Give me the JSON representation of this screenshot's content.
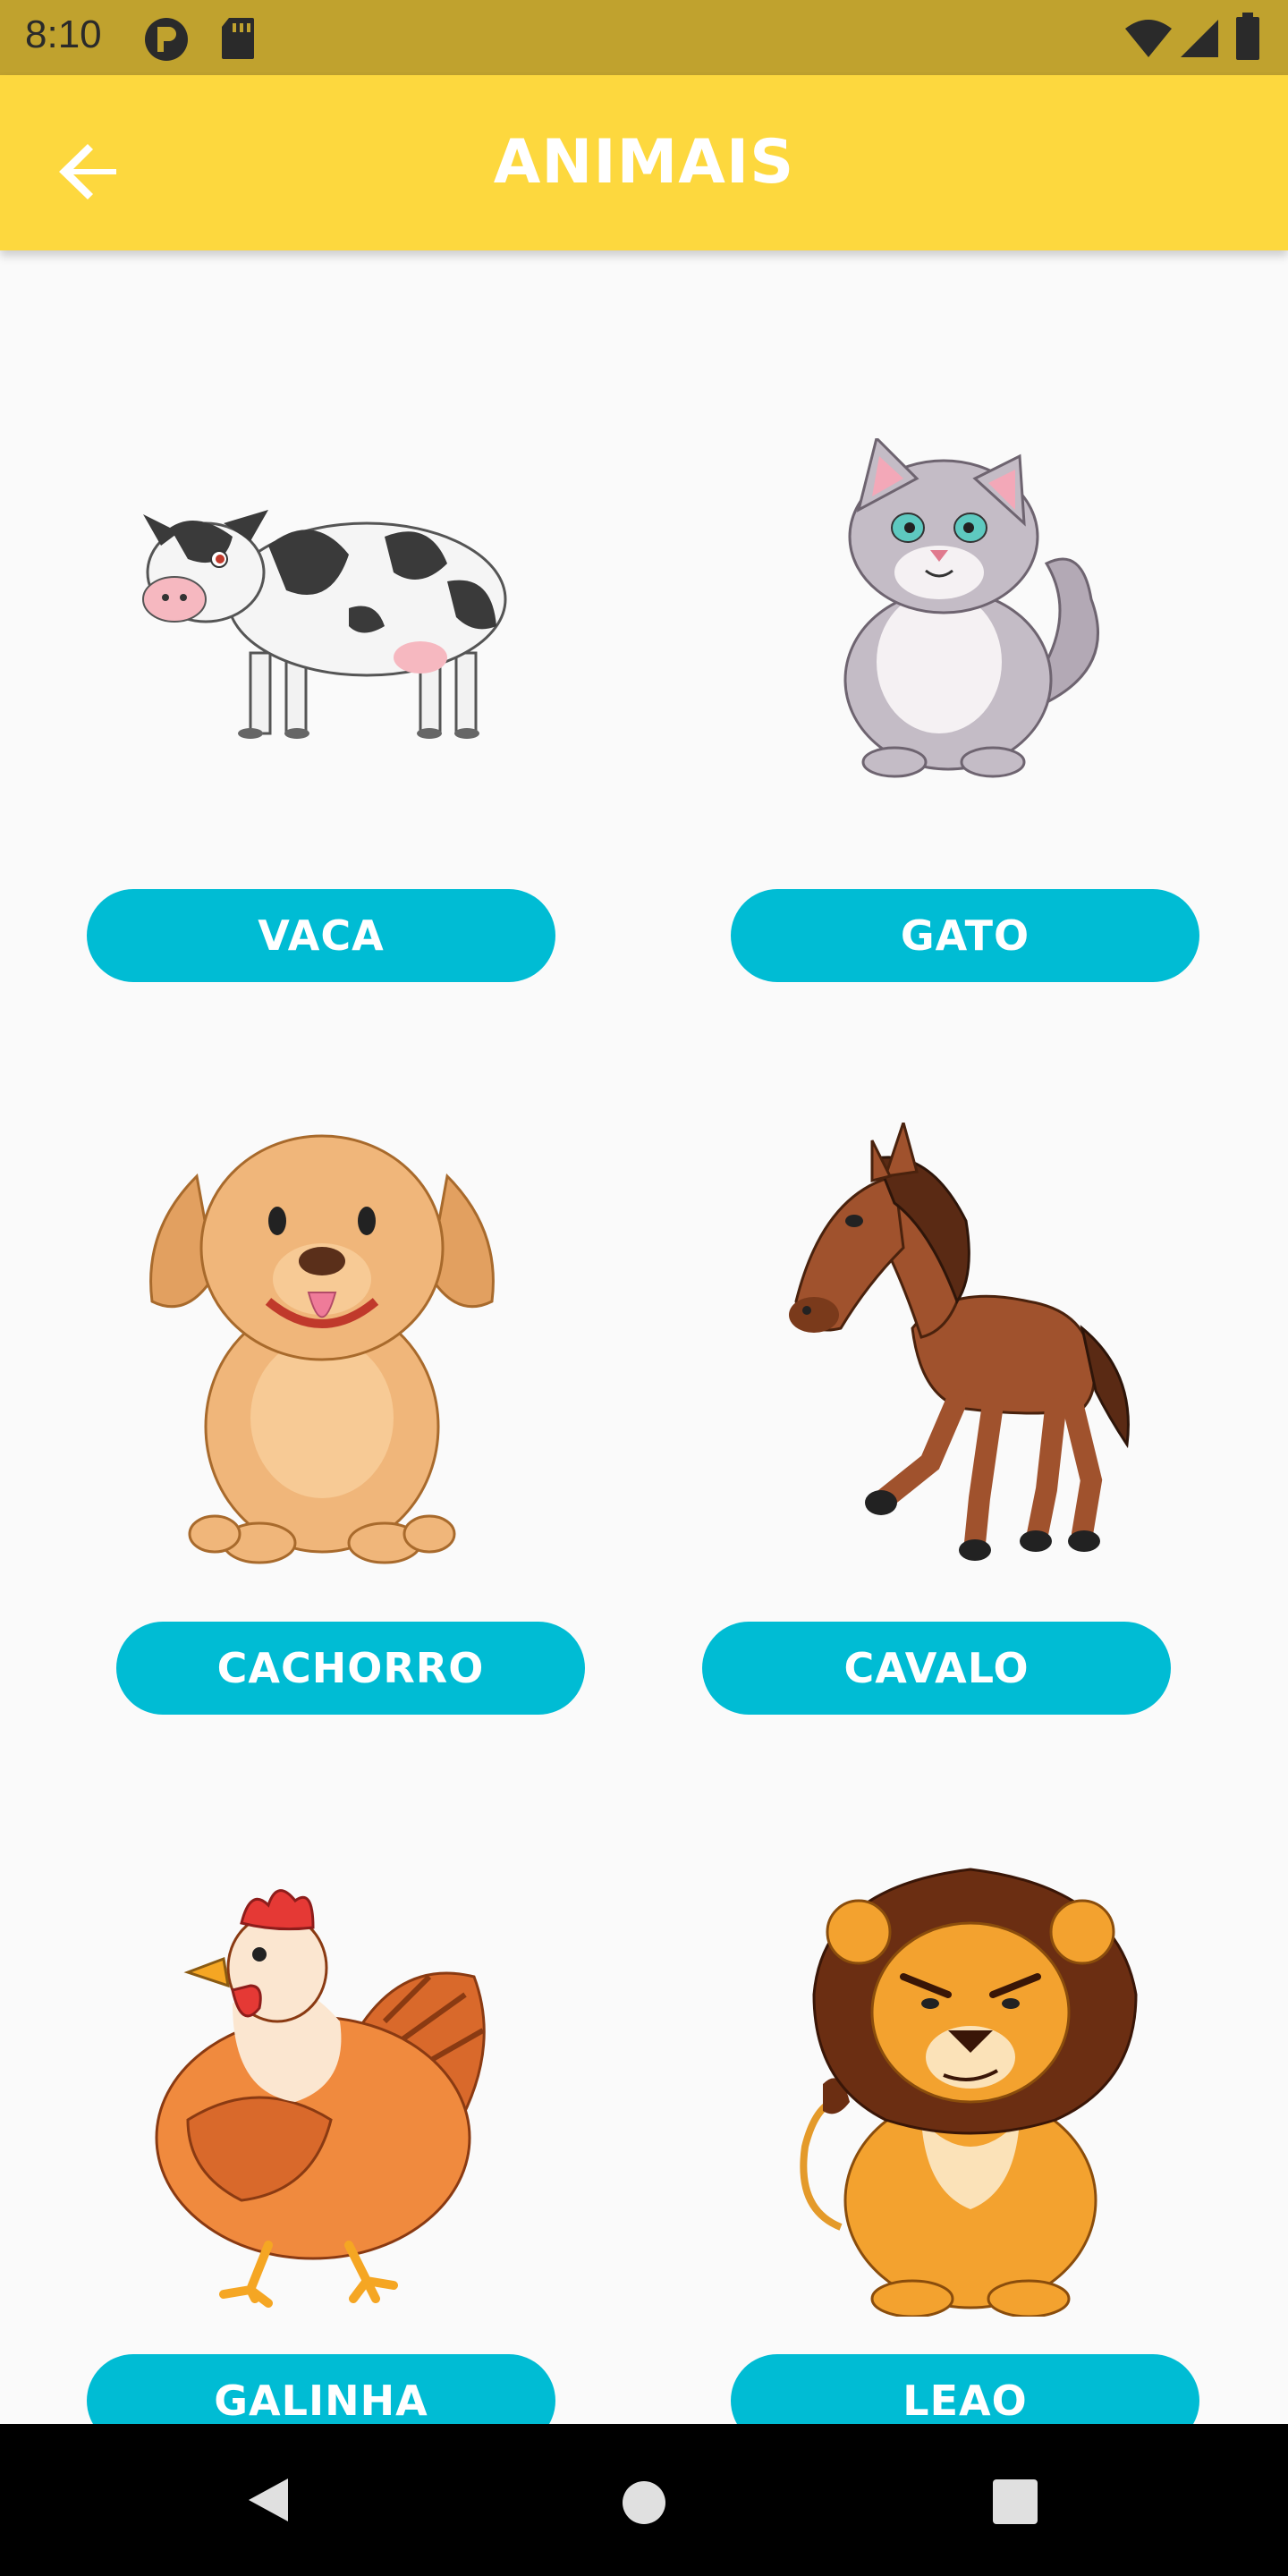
{
  "status_bar": {
    "time": "8:10",
    "icons": [
      "notification-icon",
      "sd-card-icon",
      "wifi-icon",
      "signal-icon",
      "battery-icon"
    ]
  },
  "app_bar": {
    "title": "ANIMAIS",
    "back_icon": "arrow-back-icon"
  },
  "animals": [
    {
      "name": "cow",
      "label": "VACA"
    },
    {
      "name": "cat",
      "label": "GATO"
    },
    {
      "name": "dog",
      "label": "CACHORRO"
    },
    {
      "name": "horse",
      "label": "CAVALO"
    },
    {
      "name": "chicken",
      "label": "GALINHA"
    },
    {
      "name": "lion",
      "label": "LEAO"
    }
  ],
  "nav_bar": {
    "buttons": [
      "back-triangle-icon",
      "home-circle-icon",
      "recents-square-icon"
    ]
  },
  "colors": {
    "status_bar": "#c0a22e",
    "app_bar": "#fdd83e",
    "button": "#00bcd4",
    "background": "#fafafa",
    "nav_bar": "#000000"
  }
}
